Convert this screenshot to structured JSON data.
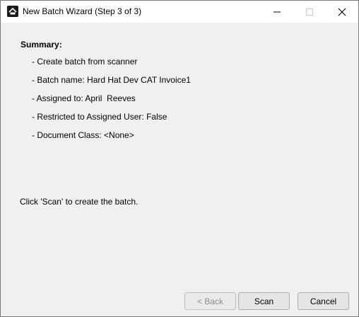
{
  "window": {
    "title": "New Batch Wizard (Step 3 of 3)",
    "app_icon": "app-logo-icon",
    "controls": [
      "minimize-icon",
      "maximize-icon",
      "close-icon"
    ]
  },
  "summary": {
    "heading": "Summary:",
    "items": [
      "- Create batch from scanner",
      "- Batch name: Hard Hat Dev CAT Invoice1",
      "- Assigned to: April  Reeves",
      "- Restricted to Assigned User: False",
      "- Document Class: <None>"
    ]
  },
  "instruction": "Click 'Scan' to create the batch.",
  "buttons": {
    "back": "< Back",
    "scan": "Scan",
    "cancel": "Cancel"
  }
}
